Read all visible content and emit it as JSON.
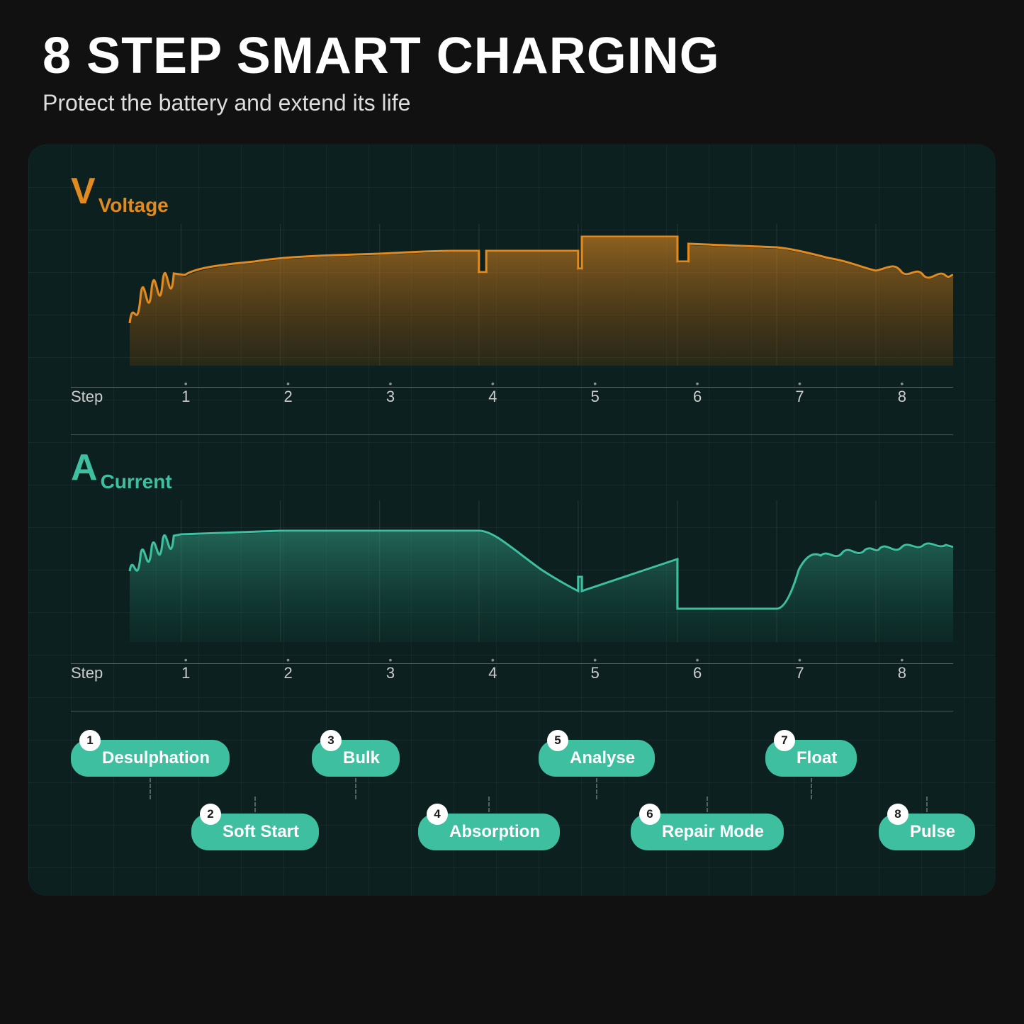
{
  "header": {
    "title": "8 STEP SMART CHARGING",
    "subtitle": "Protect the battery and extend its life"
  },
  "voltage": {
    "letter": "V",
    "label": "Voltage"
  },
  "current": {
    "letter": "A",
    "label": "Current"
  },
  "steps_axis": {
    "label": "Step",
    "numbers": [
      "1",
      "2",
      "3",
      "4",
      "5",
      "6",
      "7",
      "8"
    ]
  },
  "steps": [
    {
      "num": "1",
      "label": "Desulphation",
      "row": "top",
      "pos": 0
    },
    {
      "num": "2",
      "label": "Soft Start",
      "row": "bottom",
      "pos": 1
    },
    {
      "num": "3",
      "label": "Bulk",
      "row": "top",
      "pos": 2
    },
    {
      "num": "4",
      "label": "Absorption",
      "row": "bottom",
      "pos": 3
    },
    {
      "num": "5",
      "label": "Analyse",
      "row": "top",
      "pos": 4
    },
    {
      "num": "6",
      "label": "Repair Mode",
      "row": "bottom",
      "pos": 5
    },
    {
      "num": "7",
      "label": "Float",
      "row": "top",
      "pos": 6
    },
    {
      "num": "8",
      "label": "Pulse",
      "row": "bottom",
      "pos": 7
    }
  ],
  "colors": {
    "voltage": "#E08A20",
    "current": "#3DBFA0",
    "background": "#0d2020",
    "page_bg": "#111"
  }
}
